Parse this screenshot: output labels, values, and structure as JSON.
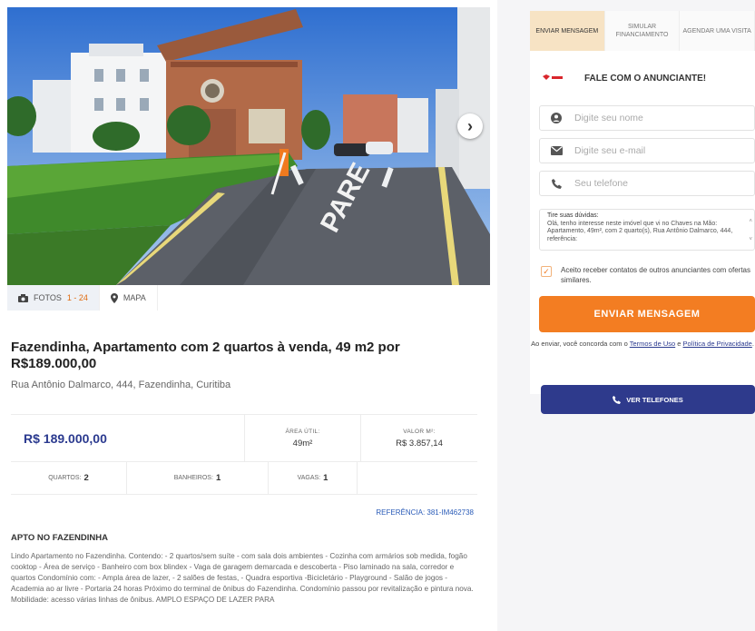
{
  "gallery": {
    "photos_label": "FOTOS",
    "photos_count": "1 - 24",
    "map_label": "MAPA",
    "gate_sign": "PARE"
  },
  "listing": {
    "title": "Fazendinha, Apartamento com 2 quartos à venda, 49 m2 por R$189.000,00",
    "address": "Rua Antônio Dalmarco, 444, Fazendinha, Curitiba",
    "price": "R$ 189.000,00",
    "area_label": "ÁREA ÚTIL:",
    "area_value": "49m²",
    "price_m2_label": "VALOR M²:",
    "price_m2_value": "R$ 3.857,14",
    "rooms_label": "QUARTOS:",
    "rooms_value": "2",
    "baths_label": "BANHEIROS:",
    "baths_value": "1",
    "parking_label": "VAGAS:",
    "parking_value": "1",
    "reference": "REFERÊNCIA: 381-IM462738",
    "desc_title": "APTO NO FAZENDINHA",
    "description": "Lindo Apartamento no Fazendinha. Contendo: - 2 quartos/sem suíte - com sala dois ambientes - Cozinha com armários sob medida, fogão cooktop - Área de serviço - Banheiro com box blindex - Vaga de garagem demarcada e descoberta - Piso laminado na sala, corredor e quartos Condomínio com: - Ampla área de lazer, - 2 salões de festas, - Quadra esportiva -Bicicletário - Playground - Salão de jogos - Academia ao ar livre - Portaria 24 horas Próximo do terminal de ônibus do Fazendinha. Condomínio passou por revitalização e pintura nova. Mobilidade: acesso várias linhas de ônibus. AMPLO ESPAÇO DE LAZER PARA"
  },
  "contact_tabs": {
    "message": "ENVIAR MENSAGEM",
    "simulate": "SIMULAR FINANCIAMENTO",
    "visit": "AGENDAR UMA VISITA"
  },
  "contact": {
    "title": "FALE COM O ANUNCIANTE!",
    "name_placeholder": "Digite seu nome",
    "email_placeholder": "Digite seu e-mail",
    "phone_placeholder": "Seu telefone",
    "message_label": "Tire suas dúvidas:",
    "message_text": "Olá, tenho interesse neste imóvel que vi no Chaves na Mão: Apartamento, 49m², com 2 quarto(s), Rua Antônio Dalmarco, 444, referência:",
    "consent": "Aceito receber contatos de outros anunciantes com ofertas similares.",
    "send_button": "ENVIAR MENSAGEM",
    "terms_prefix": "Ao enviar, você concorda com o",
    "terms_link": "Termos de Uso",
    "terms_and": "e",
    "privacy_link": "Política de Privacidade",
    "terms_suffix": "."
  },
  "phones_button": "VER TELEFONES",
  "colors": {
    "brand_blue": "#2e3a8c",
    "accent_orange": "#f37d22",
    "tab_active": "#f7e3c4"
  }
}
